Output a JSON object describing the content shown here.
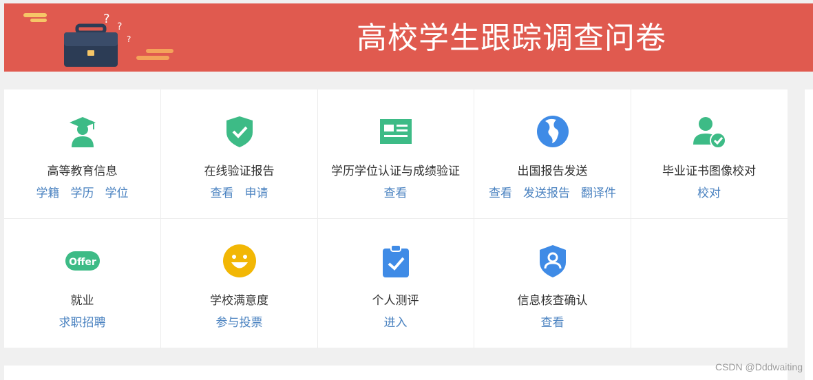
{
  "banner": {
    "title": "高校学生跟踪调查问卷"
  },
  "colors": {
    "banner_bg": "#e05a4f",
    "link": "#4a82c0",
    "icon_green": "#3dbb86",
    "icon_blue": "#3f8be6",
    "icon_yellow": "#f2b705"
  },
  "cards": [
    {
      "title": "高等教育信息",
      "icon": "graduate-icon",
      "links": [
        "学籍",
        "学历",
        "学位"
      ]
    },
    {
      "title": "在线验证报告",
      "icon": "shield-check-icon",
      "links": [
        "查看",
        "申请"
      ]
    },
    {
      "title": "学历学位认证与成绩验证",
      "icon": "id-card-icon",
      "links": [
        "查看"
      ]
    },
    {
      "title": "出国报告发送",
      "icon": "globe-icon",
      "links": [
        "查看",
        "发送报告",
        "翻译件"
      ]
    },
    {
      "title": "毕业证书图像校对",
      "icon": "user-check-icon",
      "links": [
        "校对"
      ]
    },
    {
      "title": "就业",
      "icon": "offer-icon",
      "links": [
        "求职招聘"
      ],
      "badge": "Offer"
    },
    {
      "title": "学校满意度",
      "icon": "smiley-icon",
      "links": [
        "参与投票"
      ]
    },
    {
      "title": "个人测评",
      "icon": "clipboard-check-icon",
      "links": [
        "进入"
      ]
    },
    {
      "title": "信息核查确认",
      "icon": "shield-user-icon",
      "links": [
        "查看"
      ]
    }
  ],
  "watermark": "CSDN @Dddwaiting"
}
